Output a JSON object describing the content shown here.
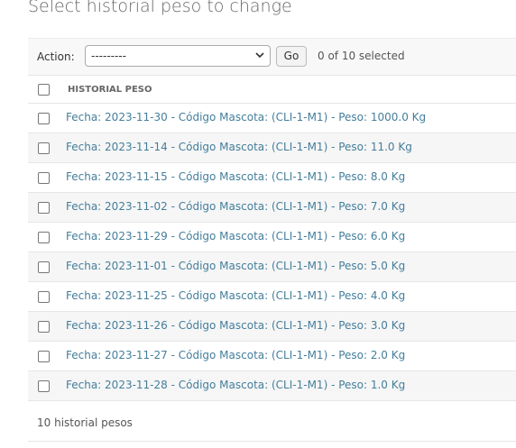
{
  "header": {
    "title": "Select historial peso to change"
  },
  "actions": {
    "label": "Action:",
    "select_value": "---------",
    "go_label": "Go",
    "selected_count": "0 of 10 selected"
  },
  "table": {
    "column_header": "HISTORIAL PESO",
    "rows": [
      "Fecha: 2023-11-30 - Código Mascota: (CLI-1-M1) - Peso: 1000.0 Kg",
      "Fecha: 2023-11-14 - Código Mascota: (CLI-1-M1) - Peso: 11.0 Kg",
      "Fecha: 2023-11-15 - Código Mascota: (CLI-1-M1) - Peso: 8.0 Kg",
      "Fecha: 2023-11-02 - Código Mascota: (CLI-1-M1) - Peso: 7.0 Kg",
      "Fecha: 2023-11-29 - Código Mascota: (CLI-1-M1) - Peso: 6.0 Kg",
      "Fecha: 2023-11-01 - Código Mascota: (CLI-1-M1) - Peso: 5.0 Kg",
      "Fecha: 2023-11-25 - Código Mascota: (CLI-1-M1) - Peso: 4.0 Kg",
      "Fecha: 2023-11-26 - Código Mascota: (CLI-1-M1) - Peso: 3.0 Kg",
      "Fecha: 2023-11-27 - Código Mascota: (CLI-1-M1) - Peso: 2.0 Kg",
      "Fecha: 2023-11-28 - Código Mascota: (CLI-1-M1) - Peso: 1.0 Kg"
    ]
  },
  "paginator": {
    "text": "10 historial pesos"
  },
  "colors": {
    "link": "#447e9b",
    "row_alt": "#f6f6f6",
    "toolbar_bg": "#f8f8f8"
  },
  "icons": {
    "dropdown": "chevron-down-icon",
    "checkbox": "checkbox-icon"
  }
}
